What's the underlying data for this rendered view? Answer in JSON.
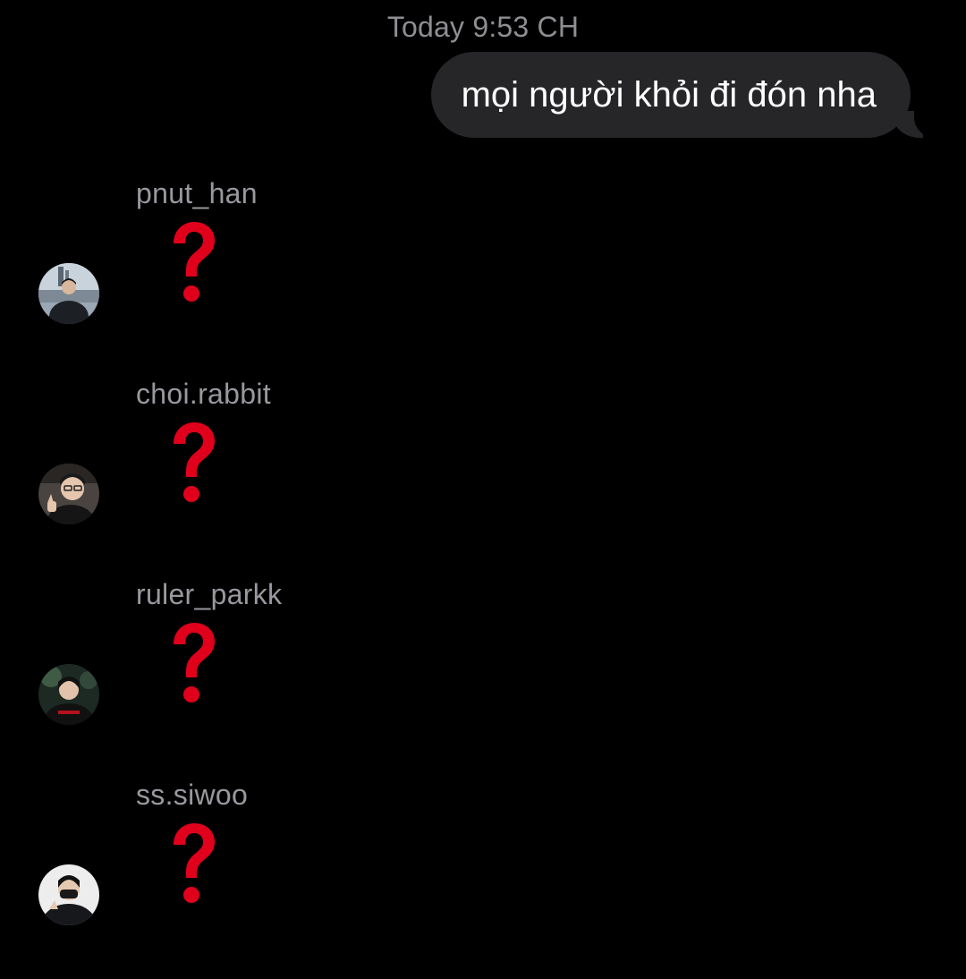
{
  "conversation": {
    "timestamp": "Today 9:53 CH",
    "outgoing_message": "mọi người khỏi đi đón nha",
    "bubble_color": "#262629",
    "reaction_emoji": "❓",
    "reaction_color": "#e0001b",
    "replies": [
      {
        "sender": "pnut_han",
        "content": "❓"
      },
      {
        "sender": "choi.rabbit",
        "content": "❓"
      },
      {
        "sender": "ruler_parkk",
        "content": "❓"
      },
      {
        "sender": "ss.siwoo",
        "content": "❓"
      }
    ]
  }
}
